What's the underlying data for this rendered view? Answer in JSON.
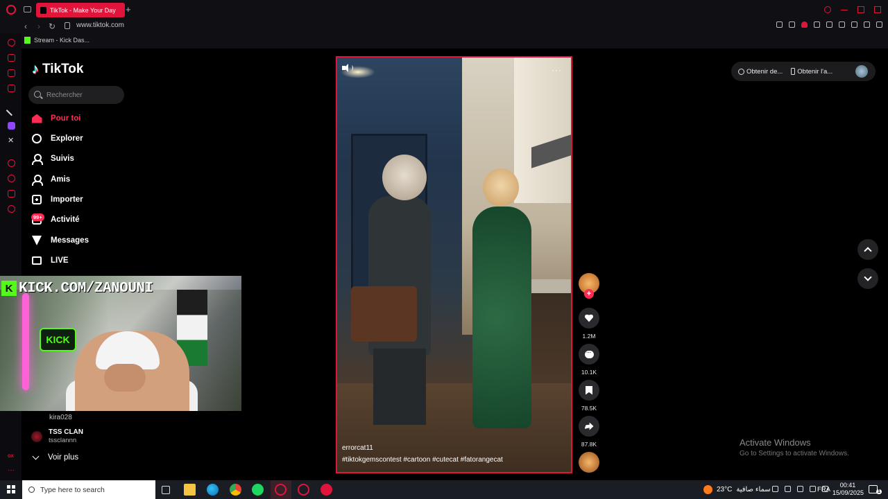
{
  "browser": {
    "tab_title": "TikTok - Make Your Day",
    "url": "www.tiktok.com",
    "bookmark_label": "Stream - Kick Das...",
    "accent_color": "#e1153c"
  },
  "tiktok": {
    "brand": "TikTok",
    "search_placeholder": "Rechercher",
    "nav": [
      {
        "label": "Pour toi",
        "icon": "home-icon",
        "active": true
      },
      {
        "label": "Explorer",
        "icon": "compass-icon"
      },
      {
        "label": "Suivis",
        "icon": "following-icon"
      },
      {
        "label": "Amis",
        "icon": "friends-icon"
      },
      {
        "label": "Importer",
        "icon": "upload-icon"
      },
      {
        "label": "Activité",
        "icon": "activity-icon",
        "badge": "99+"
      },
      {
        "label": "Messages",
        "icon": "send-icon"
      },
      {
        "label": "LIVE",
        "icon": "live-icon"
      }
    ],
    "following": [
      {
        "name": "",
        "handle": "kira028"
      },
      {
        "name": "TSS CLAN",
        "handle": "tssclannn"
      }
    ],
    "see_more": "Voir plus",
    "accent_color": "#fe2c55"
  },
  "stream_overlay": {
    "banner_text": "KICK.COM/ZANOUNI"
  },
  "video": {
    "author": "errorcat11",
    "hashtags": "#tiktokgemscontest  #cartoon  #cutecat  #fatorangecat",
    "likes": "1.2M",
    "comments": "10.1K",
    "bookmarks": "78.5K",
    "shares": "87.8K"
  },
  "header_pill": {
    "get_desktop": "Obtenir de...",
    "get_app": "Obtenir l'a..."
  },
  "windows_activation": {
    "title": "Activate Windows",
    "subtitle": "Go to Settings to activate Windows."
  },
  "taskbar": {
    "search_placeholder": "Type here to search",
    "temperature": "23°C",
    "weather_text": "سماء صافية",
    "language": "FRA",
    "time": "00:41",
    "date": "15/09/2025"
  }
}
